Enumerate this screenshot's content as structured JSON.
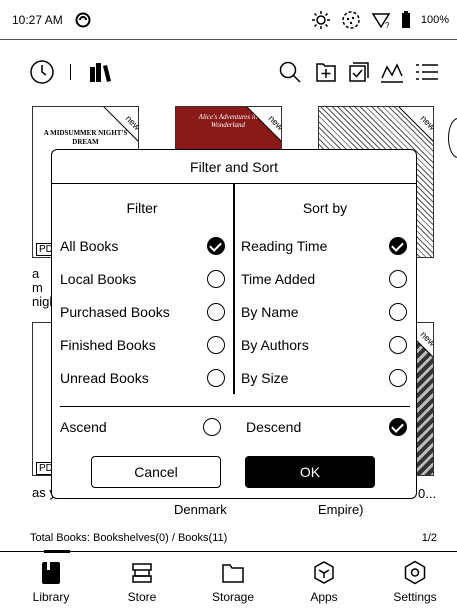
{
  "status": {
    "time": "10:27 AM",
    "battery": "100%"
  },
  "books": {
    "b1_cover_title": "A MIDSUMMER NIGHT'S DREAM",
    "b2_cover_title": "Alice's Adventures in Wonderland",
    "badge": "new",
    "b1_tag": "PDF",
    "b4_tag": "PDF",
    "b1_title_partial": "a m nigh",
    "b4_title_partial": "as y",
    "b5_title_below": "Denmark",
    "b6_title_below": "Empire)",
    "b6_title_right": "0..."
  },
  "dialog": {
    "title": "Filter and Sort",
    "filter_header": "Filter",
    "sort_header": "Sort by",
    "filter_options": [
      {
        "label": "All Books",
        "checked": true
      },
      {
        "label": "Local Books",
        "checked": false
      },
      {
        "label": "Purchased Books",
        "checked": false
      },
      {
        "label": "Finished Books",
        "checked": false
      },
      {
        "label": "Unread Books",
        "checked": false
      }
    ],
    "sort_options": [
      {
        "label": "Reading Time",
        "checked": true
      },
      {
        "label": "Time Added",
        "checked": false
      },
      {
        "label": "By Name",
        "checked": false
      },
      {
        "label": "By Authors",
        "checked": false
      },
      {
        "label": "By Size",
        "checked": false
      }
    ],
    "ascend_label": "Ascend",
    "descend_label": "Descend",
    "ascend_checked": false,
    "descend_checked": true,
    "cancel_label": "Cancel",
    "ok_label": "OK"
  },
  "footer": {
    "total": "Total Books: Bookshelves(0) / Books(11)",
    "page": "1/2"
  },
  "nav": [
    {
      "label": "Library",
      "icon": "library-icon",
      "active": true
    },
    {
      "label": "Store",
      "icon": "store-icon",
      "active": false
    },
    {
      "label": "Storage",
      "icon": "folder-icon",
      "active": false
    },
    {
      "label": "Apps",
      "icon": "apps-icon",
      "active": false
    },
    {
      "label": "Settings",
      "icon": "settings-icon",
      "active": false
    }
  ]
}
